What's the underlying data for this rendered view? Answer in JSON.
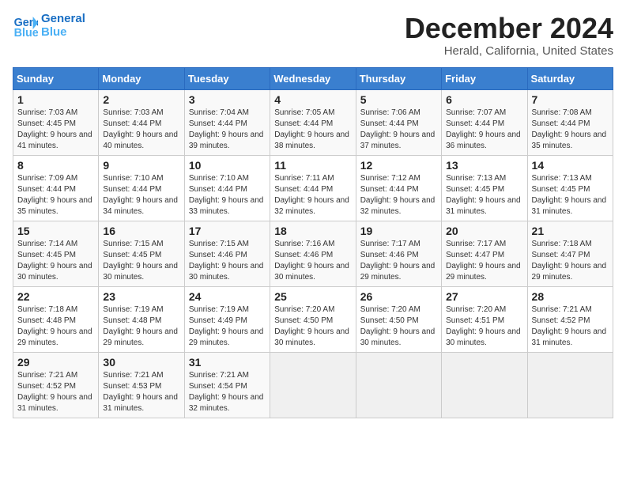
{
  "logo": {
    "line1": "General",
    "line2": "Blue"
  },
  "title": "December 2024",
  "subtitle": "Herald, California, United States",
  "days_header": [
    "Sunday",
    "Monday",
    "Tuesday",
    "Wednesday",
    "Thursday",
    "Friday",
    "Saturday"
  ],
  "weeks": [
    [
      {
        "day": "1",
        "sunrise": "Sunrise: 7:03 AM",
        "sunset": "Sunset: 4:45 PM",
        "daylight": "Daylight: 9 hours and 41 minutes."
      },
      {
        "day": "2",
        "sunrise": "Sunrise: 7:03 AM",
        "sunset": "Sunset: 4:44 PM",
        "daylight": "Daylight: 9 hours and 40 minutes."
      },
      {
        "day": "3",
        "sunrise": "Sunrise: 7:04 AM",
        "sunset": "Sunset: 4:44 PM",
        "daylight": "Daylight: 9 hours and 39 minutes."
      },
      {
        "day": "4",
        "sunrise": "Sunrise: 7:05 AM",
        "sunset": "Sunset: 4:44 PM",
        "daylight": "Daylight: 9 hours and 38 minutes."
      },
      {
        "day": "5",
        "sunrise": "Sunrise: 7:06 AM",
        "sunset": "Sunset: 4:44 PM",
        "daylight": "Daylight: 9 hours and 37 minutes."
      },
      {
        "day": "6",
        "sunrise": "Sunrise: 7:07 AM",
        "sunset": "Sunset: 4:44 PM",
        "daylight": "Daylight: 9 hours and 36 minutes."
      },
      {
        "day": "7",
        "sunrise": "Sunrise: 7:08 AM",
        "sunset": "Sunset: 4:44 PM",
        "daylight": "Daylight: 9 hours and 35 minutes."
      }
    ],
    [
      {
        "day": "8",
        "sunrise": "Sunrise: 7:09 AM",
        "sunset": "Sunset: 4:44 PM",
        "daylight": "Daylight: 9 hours and 35 minutes."
      },
      {
        "day": "9",
        "sunrise": "Sunrise: 7:10 AM",
        "sunset": "Sunset: 4:44 PM",
        "daylight": "Daylight: 9 hours and 34 minutes."
      },
      {
        "day": "10",
        "sunrise": "Sunrise: 7:10 AM",
        "sunset": "Sunset: 4:44 PM",
        "daylight": "Daylight: 9 hours and 33 minutes."
      },
      {
        "day": "11",
        "sunrise": "Sunrise: 7:11 AM",
        "sunset": "Sunset: 4:44 PM",
        "daylight": "Daylight: 9 hours and 32 minutes."
      },
      {
        "day": "12",
        "sunrise": "Sunrise: 7:12 AM",
        "sunset": "Sunset: 4:44 PM",
        "daylight": "Daylight: 9 hours and 32 minutes."
      },
      {
        "day": "13",
        "sunrise": "Sunrise: 7:13 AM",
        "sunset": "Sunset: 4:45 PM",
        "daylight": "Daylight: 9 hours and 31 minutes."
      },
      {
        "day": "14",
        "sunrise": "Sunrise: 7:13 AM",
        "sunset": "Sunset: 4:45 PM",
        "daylight": "Daylight: 9 hours and 31 minutes."
      }
    ],
    [
      {
        "day": "15",
        "sunrise": "Sunrise: 7:14 AM",
        "sunset": "Sunset: 4:45 PM",
        "daylight": "Daylight: 9 hours and 30 minutes."
      },
      {
        "day": "16",
        "sunrise": "Sunrise: 7:15 AM",
        "sunset": "Sunset: 4:45 PM",
        "daylight": "Daylight: 9 hours and 30 minutes."
      },
      {
        "day": "17",
        "sunrise": "Sunrise: 7:15 AM",
        "sunset": "Sunset: 4:46 PM",
        "daylight": "Daylight: 9 hours and 30 minutes."
      },
      {
        "day": "18",
        "sunrise": "Sunrise: 7:16 AM",
        "sunset": "Sunset: 4:46 PM",
        "daylight": "Daylight: 9 hours and 30 minutes."
      },
      {
        "day": "19",
        "sunrise": "Sunrise: 7:17 AM",
        "sunset": "Sunset: 4:46 PM",
        "daylight": "Daylight: 9 hours and 29 minutes."
      },
      {
        "day": "20",
        "sunrise": "Sunrise: 7:17 AM",
        "sunset": "Sunset: 4:47 PM",
        "daylight": "Daylight: 9 hours and 29 minutes."
      },
      {
        "day": "21",
        "sunrise": "Sunrise: 7:18 AM",
        "sunset": "Sunset: 4:47 PM",
        "daylight": "Daylight: 9 hours and 29 minutes."
      }
    ],
    [
      {
        "day": "22",
        "sunrise": "Sunrise: 7:18 AM",
        "sunset": "Sunset: 4:48 PM",
        "daylight": "Daylight: 9 hours and 29 minutes."
      },
      {
        "day": "23",
        "sunrise": "Sunrise: 7:19 AM",
        "sunset": "Sunset: 4:48 PM",
        "daylight": "Daylight: 9 hours and 29 minutes."
      },
      {
        "day": "24",
        "sunrise": "Sunrise: 7:19 AM",
        "sunset": "Sunset: 4:49 PM",
        "daylight": "Daylight: 9 hours and 29 minutes."
      },
      {
        "day": "25",
        "sunrise": "Sunrise: 7:20 AM",
        "sunset": "Sunset: 4:50 PM",
        "daylight": "Daylight: 9 hours and 30 minutes."
      },
      {
        "day": "26",
        "sunrise": "Sunrise: 7:20 AM",
        "sunset": "Sunset: 4:50 PM",
        "daylight": "Daylight: 9 hours and 30 minutes."
      },
      {
        "day": "27",
        "sunrise": "Sunrise: 7:20 AM",
        "sunset": "Sunset: 4:51 PM",
        "daylight": "Daylight: 9 hours and 30 minutes."
      },
      {
        "day": "28",
        "sunrise": "Sunrise: 7:21 AM",
        "sunset": "Sunset: 4:52 PM",
        "daylight": "Daylight: 9 hours and 31 minutes."
      }
    ],
    [
      {
        "day": "29",
        "sunrise": "Sunrise: 7:21 AM",
        "sunset": "Sunset: 4:52 PM",
        "daylight": "Daylight: 9 hours and 31 minutes."
      },
      {
        "day": "30",
        "sunrise": "Sunrise: 7:21 AM",
        "sunset": "Sunset: 4:53 PM",
        "daylight": "Daylight: 9 hours and 31 minutes."
      },
      {
        "day": "31",
        "sunrise": "Sunrise: 7:21 AM",
        "sunset": "Sunset: 4:54 PM",
        "daylight": "Daylight: 9 hours and 32 minutes."
      },
      null,
      null,
      null,
      null
    ]
  ]
}
